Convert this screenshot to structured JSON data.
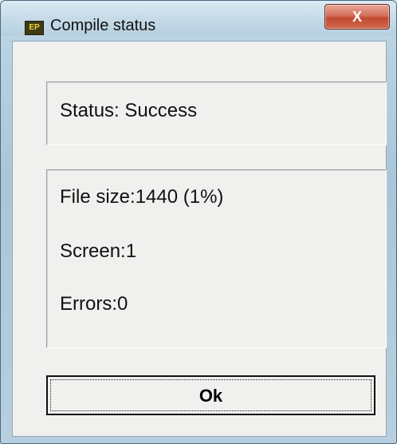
{
  "window": {
    "title": "Compile status",
    "icon": {
      "name": "ep-app-icon",
      "text": "EP"
    },
    "close_label": "X"
  },
  "status_panel": {
    "status": "Status: Success"
  },
  "info_panel": {
    "file_size": "File size:1440 (1%)",
    "screen": "Screen:1",
    "errors": "Errors:0"
  },
  "buttons": {
    "ok_label": "Ok"
  }
}
